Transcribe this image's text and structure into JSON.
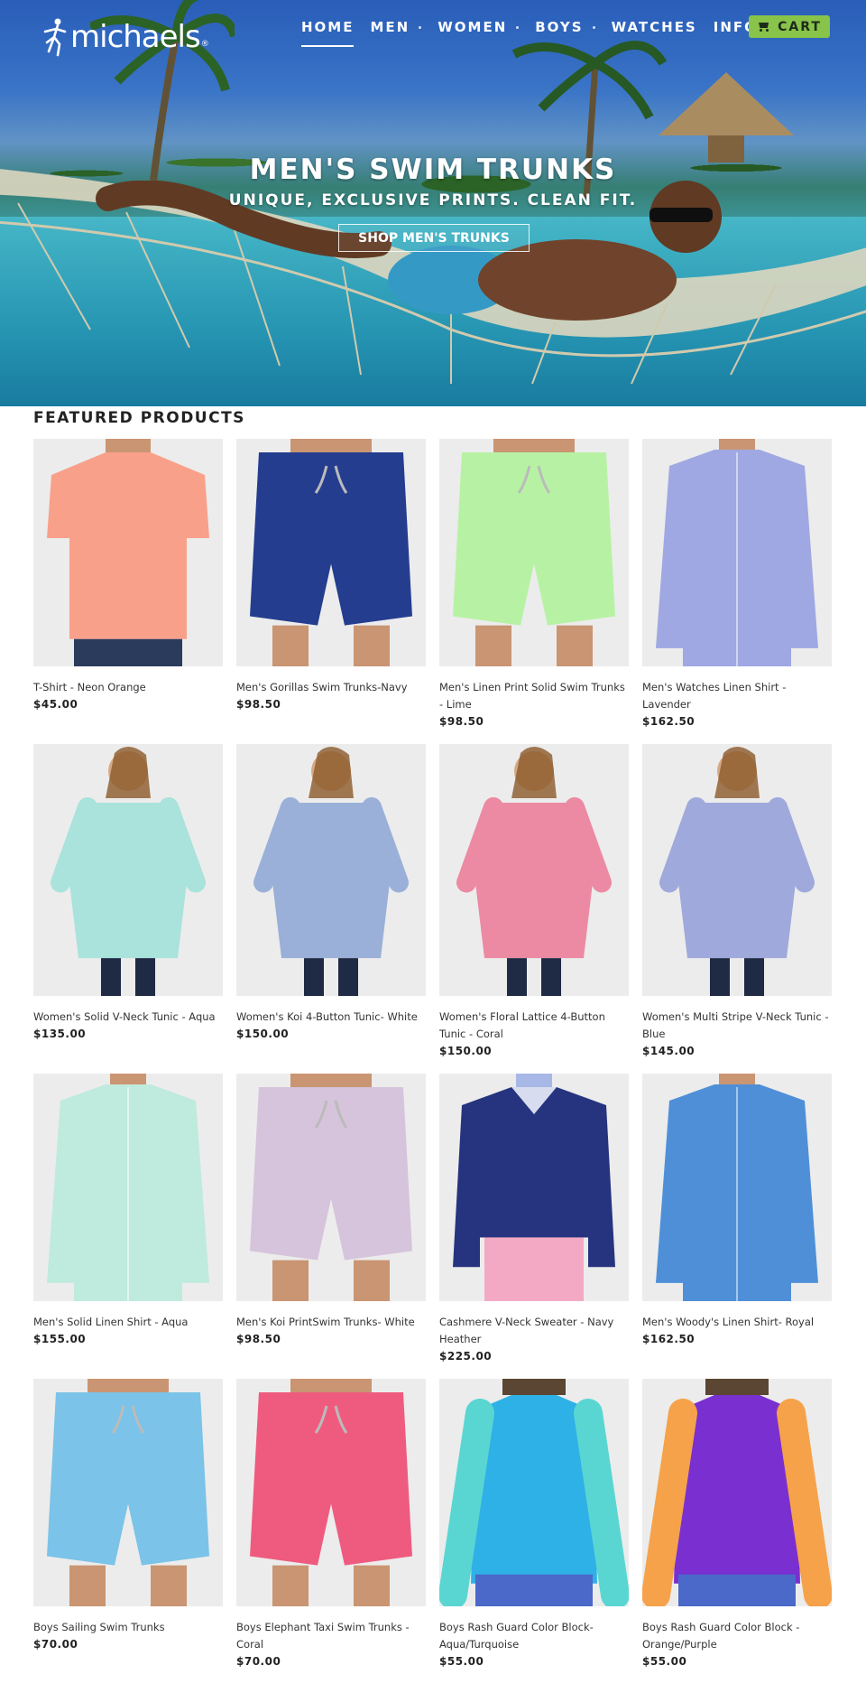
{
  "header": {
    "logo_text": "michaels",
    "logo_reg": "®",
    "nav": [
      {
        "label": "HOME",
        "active": true,
        "dropdown": false
      },
      {
        "label": "MEN",
        "active": false,
        "dropdown": true
      },
      {
        "label": "WOMEN",
        "active": false,
        "dropdown": true
      },
      {
        "label": "BOYS",
        "active": false,
        "dropdown": true
      },
      {
        "label": "WATCHES",
        "active": false,
        "dropdown": false
      },
      {
        "label": "INFO",
        "active": false,
        "dropdown": true
      }
    ],
    "search_icon": "search-icon",
    "cart_label": "CART",
    "cart_icon": "cart-icon",
    "cart_color": "#88c34a"
  },
  "hero": {
    "title": "MEN'S SWIM TRUNKS",
    "subtitle": "UNIQUE, EXCLUSIVE PRINTS. CLEAN FIT.",
    "cta_label": "SHOP MEN'S TRUNKS"
  },
  "featured": {
    "title": "FEATURED PRODUCTS",
    "products": [
      {
        "name": "T-Shirt - Neon Orange",
        "price": "$45.00",
        "color": "#f9a08a"
      },
      {
        "name": "Men's Gorillas Swim Trunks-Navy",
        "price": "$98.50",
        "color": "#243d8f"
      },
      {
        "name": "Men's Linen Print Solid Swim Trunks - Lime",
        "price": "$98.50",
        "color": "#b7f2a4"
      },
      {
        "name": "Men's Watches Linen Shirt - Lavender",
        "price": "$162.50",
        "color": "#9fa8e2"
      },
      {
        "name": "Women's Solid V-Neck Tunic - Aqua",
        "price": "$135.00",
        "color": "#a9e3db"
      },
      {
        "name": "Women's Koi 4-Button Tunic- White",
        "price": "$150.00",
        "color": "#9ab0d8"
      },
      {
        "name": "Women's Floral Lattice 4-Button Tunic - Coral",
        "price": "$150.00",
        "color": "#ec8aa3"
      },
      {
        "name": "Women's Multi Stripe V-Neck Tunic - Blue",
        "price": "$145.00",
        "color": "#9fa9dc"
      },
      {
        "name": "Men's Solid Linen Shirt - Aqua",
        "price": "$155.00",
        "color": "#bfeade"
      },
      {
        "name": "Men's Koi PrintSwim Trunks- White",
        "price": "$98.50",
        "color": "#d6c4dc"
      },
      {
        "name": "Cashmere V-Neck Sweater - Navy Heather",
        "price": "$225.00",
        "color": "#26347f"
      },
      {
        "name": "Men's Woody's Linen Shirt- Royal",
        "price": "$162.50",
        "color": "#4f8fd8"
      },
      {
        "name": "Boys Sailing Swim Trunks",
        "price": "$70.00",
        "color": "#7bc3e8"
      },
      {
        "name": "Boys Elephant Taxi Swim Trunks - Coral",
        "price": "$70.00",
        "color": "#ef5b7f"
      },
      {
        "name": "Boys Rash Guard Color Block- Aqua/Turquoise",
        "price": "$55.00",
        "color": "#2eb1e6"
      },
      {
        "name": "Boys Rash Guard Color Block - Orange/Purple",
        "price": "$55.00",
        "color": "#7a2fd0"
      }
    ]
  }
}
